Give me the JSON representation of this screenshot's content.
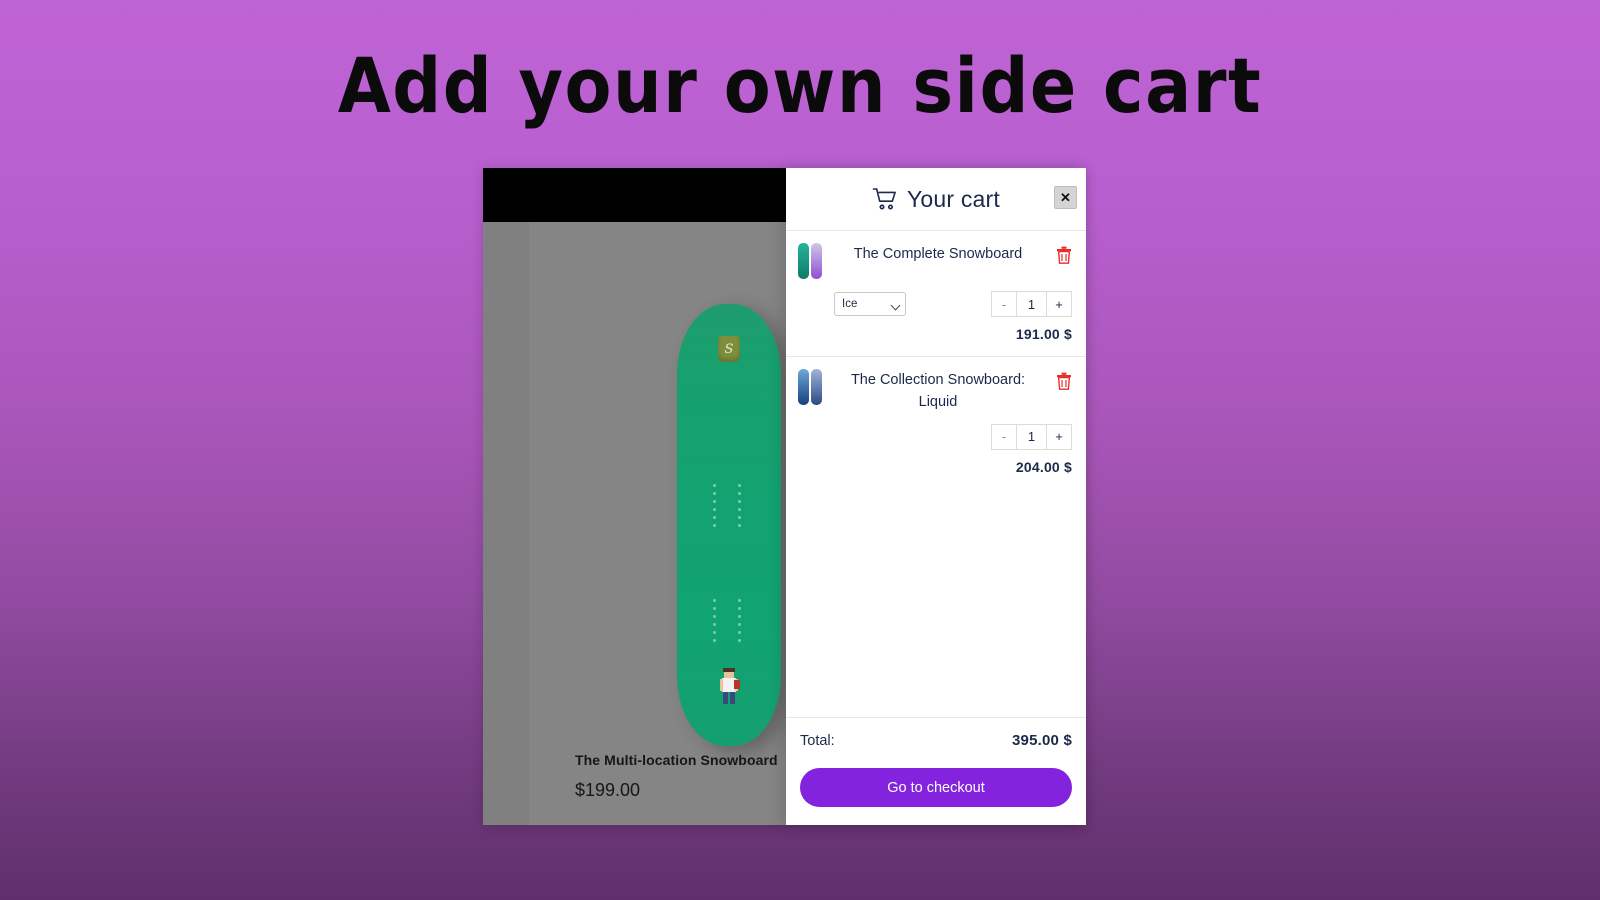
{
  "heading": "Add your own side cart",
  "store": {
    "product": {
      "title": "The Multi-location Snowboard",
      "price": "$199.00"
    }
  },
  "cart": {
    "icon": "shopping-cart-icon",
    "title": "Your cart",
    "close_label": "✕",
    "items": [
      {
        "name": "The Complete Snowboard",
        "variant_selected": "Ice",
        "variant_options": [
          "Ice"
        ],
        "quantity": "1",
        "decrement_label": "-",
        "increment_label": "+",
        "price": "191.00 $",
        "remove_label": "trash-icon",
        "thumb_colors": [
          "#1f9e86",
          "#8f4fd0"
        ]
      },
      {
        "name": "The Collection Snowboard: Liquid",
        "variant_selected": null,
        "quantity": "1",
        "decrement_label": "-",
        "increment_label": "+",
        "price": "204.00 $",
        "remove_label": "trash-icon",
        "thumb_colors": [
          "#1f5f9e",
          "#33508f"
        ]
      }
    ],
    "total_label": "Total:",
    "total_value": "395.00 $",
    "checkout_label": "Go to checkout"
  },
  "colors": {
    "background_top": "#bf63d5",
    "background_bottom": "#5f2f6b",
    "checkout_button": "#8323dd",
    "cart_text": "#1b2a4a",
    "trash": "#e8302a",
    "store_topbar": "#000000"
  }
}
